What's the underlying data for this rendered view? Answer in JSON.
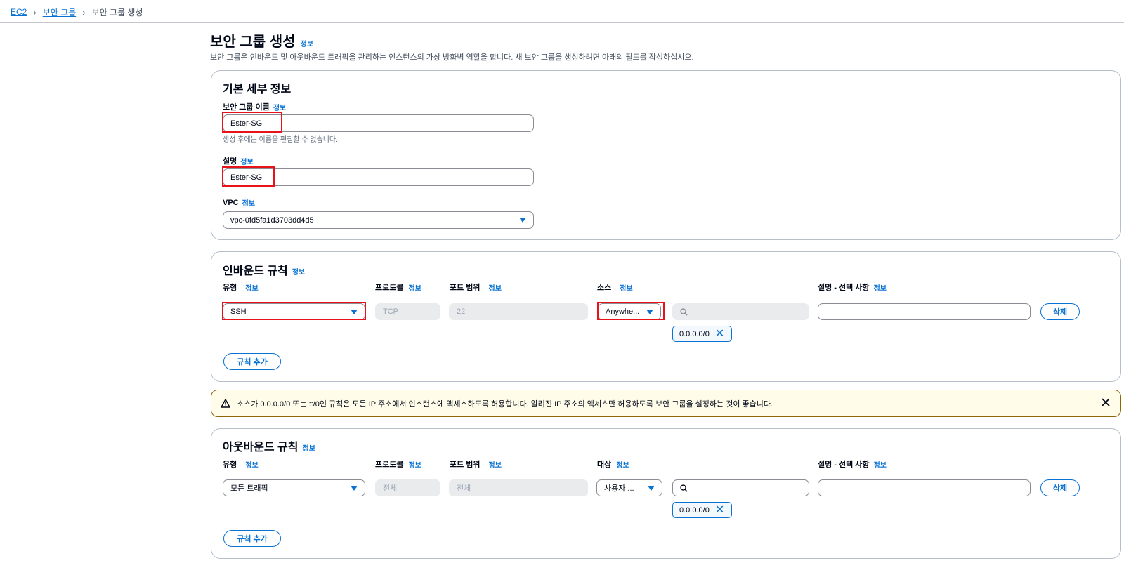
{
  "breadcrumb": {
    "items": [
      "EC2",
      "보안 그룹"
    ],
    "current": "보안 그룹 생성"
  },
  "info_label": "정보",
  "page": {
    "title": "보안 그룹 생성",
    "description": "보안 그룹은 인바운드 및 아웃바운드 트래픽을 관리하는 인스턴스의 가상 방화벽 역할을 합니다. 새 보안 그룹을 생성하려면 아래의 필드를 작성하십시오."
  },
  "basic": {
    "title": "기본 세부 정보",
    "name_label": "보안 그룹 이름",
    "name_value": "Ester-SG",
    "name_hint": "생성 후에는 이름을 편집할 수 없습니다.",
    "desc_label": "설명",
    "desc_value": "Ester-SG",
    "vpc_label": "VPC",
    "vpc_value": "vpc-0fd5fa1d3703dd4d5"
  },
  "inbound": {
    "title": "인바운드 규칙",
    "col_type": "유형",
    "col_protocol": "프로토콜",
    "col_port": "포트 범위",
    "col_source": "소스",
    "col_desc": "설명 - 선택 사항",
    "type_value": "SSH",
    "protocol_value": "TCP",
    "port_value": "22",
    "source_value": "Anywhe...",
    "search_value": "",
    "desc_value": "",
    "token": "0.0.0.0/0",
    "delete_label": "삭제",
    "add_rule_label": "규칙 추가"
  },
  "alert": {
    "text": "소스가 0.0.0.0/0 또는 ::/0인 규칙은 모든 IP 주소에서 인스턴스에 액세스하도록 허용합니다. 알려진 IP 주소의 액세스만 허용하도록 보안 그룹을 설정하는 것이 좋습니다."
  },
  "outbound": {
    "title": "아웃바운드 규칙",
    "col_type": "유형",
    "col_protocol": "프로토콜",
    "col_port": "포트 범위",
    "col_dest": "대상",
    "col_desc": "설명 - 선택 사항",
    "type_value": "모든 트래픽",
    "protocol_value": "전체",
    "port_value": "전체",
    "dest_value": "사용자 ...",
    "search_value": "",
    "desc_value": "",
    "token": "0.0.0.0/0",
    "delete_label": "삭제",
    "add_rule_label": "규칙 추가"
  },
  "colors": {
    "accent": "#0972d3",
    "highlight": "#e8121b",
    "warning_bg": "#fffce9",
    "warning_border": "#8d6605"
  }
}
